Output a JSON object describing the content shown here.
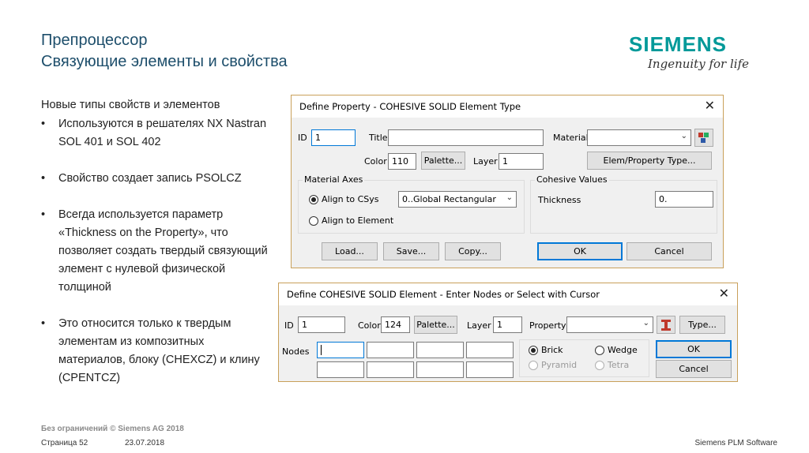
{
  "slide": {
    "title": "Препроцессор",
    "subtitle": "Связующие элементы и свойства",
    "logo": "SIEMENS",
    "logo_tagline": "Ingenuity for life",
    "lead": "Новые типы свойств и элементов",
    "bullets": [
      "Используются в решателях NX Nastran SOL 401 и SOL 402",
      "Свойство создает запись PSOLCZ",
      "Всегда используется параметр «Thickness on the Property», что позволяет создать твердый связующий элемент с нулевой физической толщиной",
      "Это относится только к твердым элементам из композитных материалов, блоку (CHEXCZ) и клину (CPENTCZ)"
    ],
    "footer_copyright": "Без ограничений © Siemens AG 2018",
    "footer_page": "Страница 52",
    "footer_date": "23.07.2018",
    "footer_company": "Siemens PLM Software"
  },
  "property_dialog": {
    "title": "Define Property - COHESIVE SOLID Element Type",
    "id_label": "ID",
    "id_value": "1",
    "title_label": "Title",
    "title_value": "",
    "material_label": "Material",
    "material_value": "",
    "color_label": "Color",
    "color_value": "110",
    "palette_button": "Palette...",
    "layer_label": "Layer",
    "layer_value": "1",
    "elem_type_button": "Elem/Property Type...",
    "material_axes_group": "Material Axes",
    "align_csys_label": "Align to CSys",
    "csys_value": "0..Global Rectangular",
    "align_element_label": "Align to Element",
    "cohesive_group": "Cohesive Values",
    "thickness_label": "Thickness",
    "thickness_value": "0.",
    "load_button": "Load...",
    "save_button": "Save...",
    "copy_button": "Copy...",
    "ok_button": "OK",
    "cancel_button": "Cancel"
  },
  "element_dialog": {
    "title": "Define COHESIVE SOLID Element - Enter Nodes or Select with Cursor",
    "id_label": "ID",
    "id_value": "1",
    "color_label": "Color",
    "color_value": "124",
    "palette_button": "Palette...",
    "layer_label": "Layer",
    "layer_value": "1",
    "property_label": "Property",
    "property_value": "",
    "type_button": "Type...",
    "nodes_label": "Nodes",
    "brick_label": "Brick",
    "wedge_label": "Wedge",
    "pyramid_label": "Pyramid",
    "tetra_label": "Tetra",
    "ok_button": "OK",
    "cancel_button": "Cancel"
  }
}
